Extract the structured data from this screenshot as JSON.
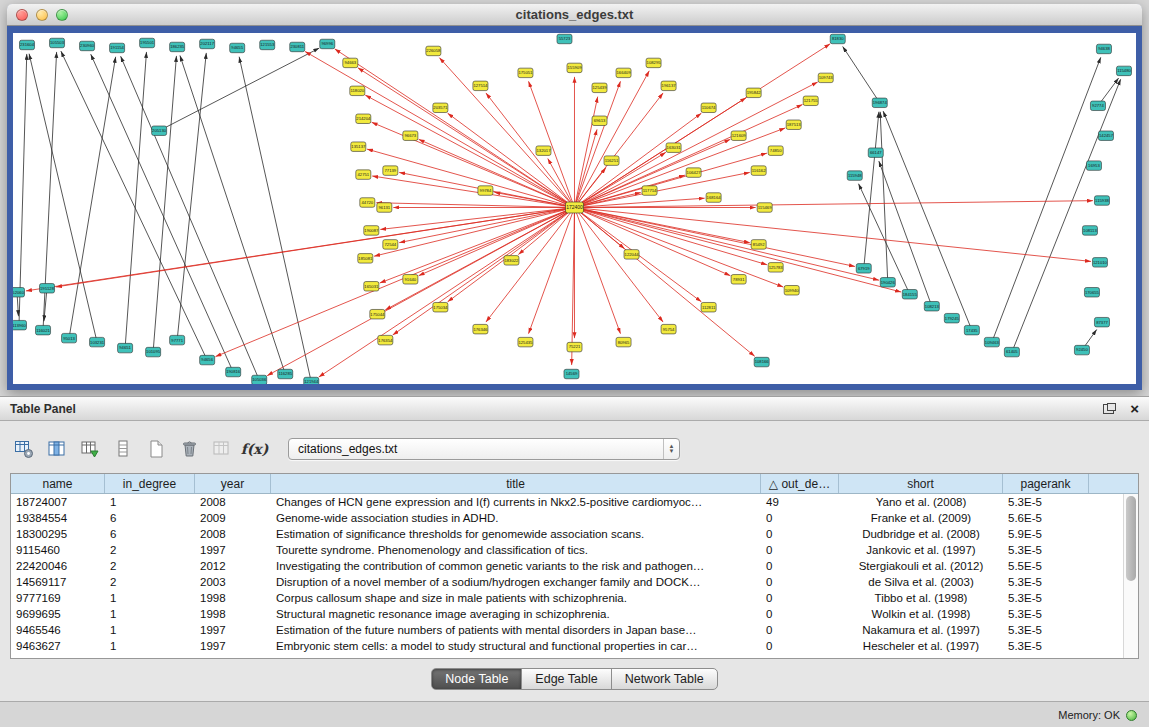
{
  "window": {
    "title": "citations_edges.txt"
  },
  "graph": {
    "colors": {
      "node_teal": "#3fc1b9",
      "node_yellow": "#f2ea3e",
      "edge_red": "#dc2a20",
      "edge_black": "#2b2b2b",
      "node_border": "#2e2e2e"
    },
    "hub_index": 0,
    "nodes": [
      [
        561,
        175,
        "y",
        "172400"
      ],
      [
        561,
        35,
        "y",
        "155909"
      ],
      [
        610,
        40,
        "y",
        "166409"
      ],
      [
        655,
        53,
        "y",
        "196137"
      ],
      [
        695,
        75,
        "y",
        "110674"
      ],
      [
        725,
        103,
        "y",
        "121609"
      ],
      [
        745,
        138,
        "y",
        "116162"
      ],
      [
        751,
        175,
        "y",
        "115469"
      ],
      [
        745,
        212,
        "y",
        "85492"
      ],
      [
        725,
        247,
        "y",
        "78931"
      ],
      [
        695,
        275,
        "y",
        "112811"
      ],
      [
        655,
        297,
        "y",
        "95754"
      ],
      [
        610,
        310,
        "y",
        "80965"
      ],
      [
        561,
        315,
        "y",
        "75221"
      ],
      [
        512,
        310,
        "y",
        "125435"
      ],
      [
        467,
        297,
        "y",
        "176346"
      ],
      [
        427,
        275,
        "y",
        "175034"
      ],
      [
        397,
        247,
        "y",
        "91640"
      ],
      [
        377,
        212,
        "y",
        "72544"
      ],
      [
        371,
        175,
        "y",
        "96131"
      ],
      [
        377,
        138,
        "y",
        "77139"
      ],
      [
        397,
        103,
        "y",
        "96673"
      ],
      [
        427,
        75,
        "y",
        "203571"
      ],
      [
        467,
        53,
        "y",
        "127514"
      ],
      [
        512,
        40,
        "y",
        "175051"
      ],
      [
        337,
        30,
        "y",
        "94663"
      ],
      [
        344,
        58,
        "y",
        "118020"
      ],
      [
        350,
        86,
        "y",
        "214204"
      ],
      [
        345,
        114,
        "y",
        "135137"
      ],
      [
        350,
        142,
        "y",
        "42751"
      ],
      [
        354,
        170,
        "y",
        "44720"
      ],
      [
        358,
        198,
        "y",
        "190087"
      ],
      [
        352,
        226,
        "y",
        "185081"
      ],
      [
        358,
        254,
        "y",
        "165031"
      ],
      [
        364,
        282,
        "y",
        "175044"
      ],
      [
        372,
        308,
        "y",
        "176354"
      ],
      [
        530,
        118,
        "y",
        "132017"
      ],
      [
        598,
        128,
        "y",
        "116251"
      ],
      [
        636,
        158,
        "y",
        "117714"
      ],
      [
        618,
        222,
        "y",
        "122044"
      ],
      [
        498,
        228,
        "y",
        "183022"
      ],
      [
        472,
        158,
        "y",
        "99784"
      ],
      [
        586,
        88,
        "y",
        "69613"
      ],
      [
        660,
        115,
        "y",
        "163031"
      ],
      [
        680,
        140,
        "y",
        "106427"
      ],
      [
        700,
        165,
        "y",
        "168164"
      ],
      [
        762,
        118,
        "y",
        "74850"
      ],
      [
        780,
        92,
        "y",
        "187513"
      ],
      [
        797,
        68,
        "y",
        "121755"
      ],
      [
        812,
        45,
        "y",
        "109743"
      ],
      [
        762,
        235,
        "y",
        "125783"
      ],
      [
        778,
        258,
        "y",
        "109940"
      ],
      [
        740,
        60,
        "y",
        "195842"
      ],
      [
        420,
        18,
        "y",
        "226058"
      ],
      [
        586,
        55,
        "y",
        "125439"
      ],
      [
        640,
        30,
        "y",
        "108295"
      ],
      [
        14,
        12,
        "t",
        "231604"
      ],
      [
        44,
        10,
        "t",
        "105503"
      ],
      [
        74,
        13,
        "t",
        "230960"
      ],
      [
        104,
        15,
        "t",
        "191154"
      ],
      [
        134,
        10,
        "t",
        "195501"
      ],
      [
        164,
        14,
        "t",
        "186235"
      ],
      [
        194,
        11,
        "t",
        "202117"
      ],
      [
        224,
        15,
        "t",
        "94655"
      ],
      [
        254,
        12,
        "t",
        "121553"
      ],
      [
        284,
        14,
        "t",
        "230811"
      ],
      [
        314,
        11,
        "t",
        "96996"
      ],
      [
        551,
        6,
        "t",
        "55723"
      ],
      [
        824,
        6,
        "t",
        "81830"
      ],
      [
        1090,
        16,
        "t",
        "94638"
      ],
      [
        1110,
        38,
        "t",
        "115480"
      ],
      [
        1084,
        73,
        "t",
        "92774"
      ],
      [
        1092,
        103,
        "t",
        "142457"
      ],
      [
        1080,
        133,
        "t",
        "16953"
      ],
      [
        1088,
        168,
        "t",
        "115938"
      ],
      [
        1076,
        198,
        "t",
        "108113"
      ],
      [
        1086,
        230,
        "t",
        "121010"
      ],
      [
        1078,
        260,
        "t",
        "170655"
      ],
      [
        1088,
        290,
        "t",
        "87377"
      ],
      [
        1068,
        318,
        "t",
        "92450"
      ],
      [
        866,
        70,
        "t",
        "196874"
      ],
      [
        850,
        236,
        "t",
        "67919"
      ],
      [
        874,
        250,
        "t",
        "190426"
      ],
      [
        896,
        262,
        "t",
        "184155"
      ],
      [
        918,
        274,
        "t",
        "108213"
      ],
      [
        938,
        286,
        "t",
        "179245"
      ],
      [
        958,
        298,
        "t",
        "17435"
      ],
      [
        978,
        310,
        "t",
        "109463"
      ],
      [
        998,
        320,
        "t",
        "61405"
      ],
      [
        4,
        260,
        "t",
        "252060"
      ],
      [
        34,
        256,
        "t",
        "195128"
      ],
      [
        6,
        293,
        "t",
        "113960"
      ],
      [
        30,
        298,
        "t",
        "116021"
      ],
      [
        56,
        306,
        "t",
        "95013"
      ],
      [
        84,
        310,
        "t",
        "103231"
      ],
      [
        112,
        316,
        "t",
        "94651"
      ],
      [
        140,
        320,
        "t",
        "101095"
      ],
      [
        164,
        308,
        "t",
        "97771"
      ],
      [
        194,
        328,
        "t",
        "94656"
      ],
      [
        220,
        340,
        "t",
        "190816"
      ],
      [
        246,
        348,
        "t",
        "105036"
      ],
      [
        272,
        342,
        "t",
        "116285"
      ],
      [
        298,
        350,
        "t",
        "121944"
      ],
      [
        558,
        342,
        "t",
        "14569"
      ],
      [
        748,
        330,
        "t",
        "108166"
      ],
      [
        146,
        98,
        "t",
        "205130"
      ],
      [
        841,
        143,
        "t",
        "115948"
      ],
      [
        862,
        120,
        "t",
        "66147"
      ]
    ],
    "red_hub_targets": [
      1,
      2,
      3,
      4,
      5,
      6,
      7,
      8,
      9,
      10,
      11,
      12,
      13,
      14,
      15,
      16,
      17,
      18,
      19,
      20,
      21,
      22,
      23,
      24,
      25,
      26,
      27,
      28,
      29,
      30,
      31,
      32,
      33,
      34,
      35,
      36,
      37,
      38,
      39,
      40,
      41,
      42,
      43,
      44,
      45,
      46,
      47,
      48,
      49,
      50,
      51,
      52,
      53,
      54,
      55,
      65,
      66,
      68,
      74,
      76,
      81,
      82,
      83,
      89,
      90,
      98,
      100,
      102,
      103,
      104
    ],
    "black_edges": [
      [
        98,
        57
      ],
      [
        99,
        58
      ],
      [
        100,
        59
      ],
      [
        101,
        61
      ],
      [
        102,
        63
      ],
      [
        95,
        60
      ],
      [
        96,
        61
      ],
      [
        94,
        56
      ],
      [
        93,
        59
      ],
      [
        97,
        62
      ],
      [
        92,
        57
      ],
      [
        91,
        56
      ],
      [
        105,
        66
      ],
      [
        80,
        68
      ],
      [
        81,
        80
      ],
      [
        82,
        80
      ],
      [
        83,
        106
      ],
      [
        84,
        107
      ],
      [
        88,
        70
      ],
      [
        87,
        69
      ],
      [
        71,
        70
      ],
      [
        79,
        78
      ],
      [
        86,
        80
      ],
      [
        89,
        91
      ],
      [
        90,
        92
      ]
    ]
  },
  "table_panel": {
    "title": "Table Panel",
    "toolbar": {
      "icons": [
        "table-settings",
        "select-columns",
        "import-table",
        "show-rows",
        "new-table",
        "delete-table",
        "table-disabled",
        "function-builder"
      ],
      "fx_label": "f(x)",
      "combo_value": "citations_edges.txt"
    },
    "table": {
      "columns": [
        "name",
        "in_degree",
        "year",
        "title",
        "△ out_de…",
        "short",
        "pagerank"
      ],
      "rows": [
        [
          "18724007",
          "1",
          "2008",
          "Changes of HCN gene expression and I(f) currents in Nkx2.5-positive cardiomyoc…",
          "49",
          "Yano et al. (2008)",
          "5.3E-5"
        ],
        [
          "19384554",
          "6",
          "2009",
          "Genome-wide association studies in ADHD.",
          "0",
          "Franke et al. (2009)",
          "5.6E-5"
        ],
        [
          "18300295",
          "6",
          "2008",
          "Estimation of significance thresholds for genomewide association scans.",
          "0",
          "Dudbridge et al. (2008)",
          "5.9E-5"
        ],
        [
          "9115460",
          "2",
          "1997",
          "Tourette syndrome. Phenomenology and classification of tics.",
          "0",
          "Jankovic et al. (1997)",
          "5.3E-5"
        ],
        [
          "22420046",
          "2",
          "2012",
          "Investigating the contribution of common genetic variants to the risk and pathogen…",
          "0",
          "Stergiakouli et al. (2012)",
          "5.5E-5"
        ],
        [
          "14569117",
          "2",
          "2003",
          "Disruption of a novel member of a sodium/hydrogen exchanger family and DOCK…",
          "0",
          "de Silva et al. (2003)",
          "5.3E-5"
        ],
        [
          "9777169",
          "1",
          "1998",
          "Corpus callosum shape and size in male patients with schizophrenia.",
          "0",
          "Tibbo et al. (1998)",
          "5.3E-5"
        ],
        [
          "9699695",
          "1",
          "1998",
          "Structural magnetic resonance image averaging in schizophrenia.",
          "0",
          "Wolkin et al. (1998)",
          "5.3E-5"
        ],
        [
          "9465546",
          "1",
          "1997",
          "Estimation of the future numbers of patients with mental disorders in Japan base…",
          "0",
          "Nakamura et al. (1997)",
          "5.3E-5"
        ],
        [
          "9463627",
          "1",
          "1997",
          "Embryonic stem cells: a model to study structural and functional properties in car…",
          "0",
          "Hescheler et al. (1997)",
          "5.3E-5"
        ]
      ]
    },
    "tabs": [
      "Node Table",
      "Edge Table",
      "Network Table"
    ],
    "active_tab": "Node Table"
  },
  "status": {
    "memory_label": "Memory: OK"
  }
}
